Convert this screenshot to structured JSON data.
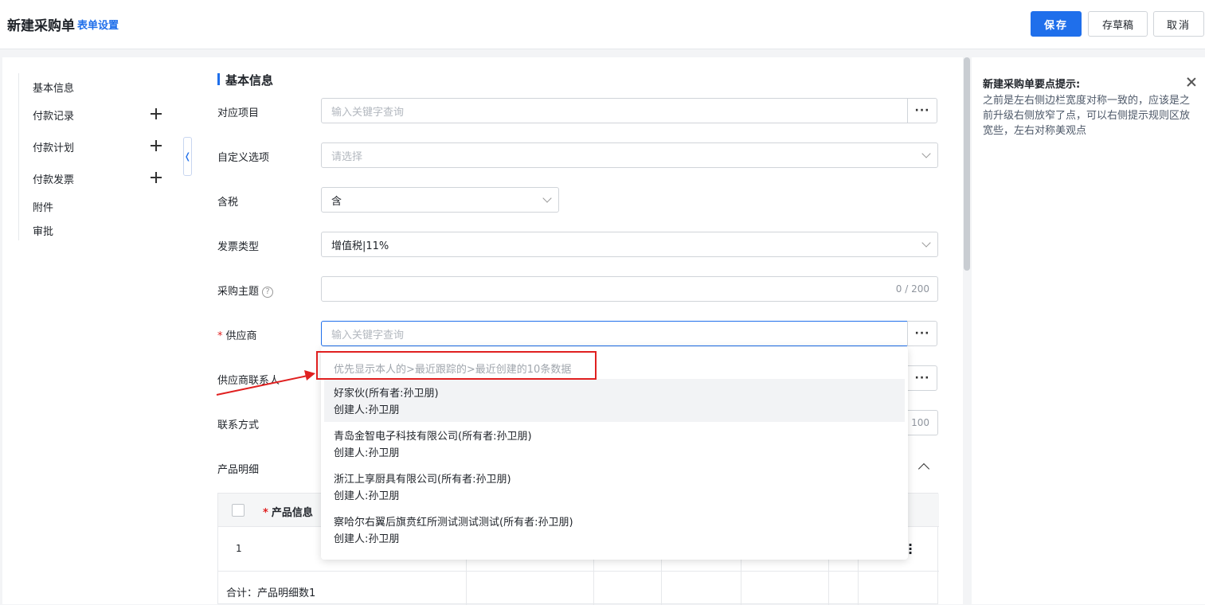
{
  "header": {
    "title": "新建采购单",
    "form_settings": "表单设置",
    "save": "保存",
    "draft": "存草稿",
    "cancel": "取消"
  },
  "sidebar": {
    "items": [
      {
        "label": "基本信息"
      },
      {
        "label": "付款记录"
      },
      {
        "label": "付款计划"
      },
      {
        "label": "付款发票"
      },
      {
        "label": "附件"
      },
      {
        "label": "审批"
      }
    ],
    "collapse_icon": "chevron-left-icon"
  },
  "form": {
    "section_title": "基本信息",
    "fields": {
      "project": {
        "label": "对应项目",
        "placeholder": "输入关键字查询"
      },
      "custom": {
        "label": "自定义选项",
        "placeholder": "请选择"
      },
      "tax": {
        "label": "含税",
        "value": "含"
      },
      "invoice_type": {
        "label": "发票类型",
        "value": "增值税|11%"
      },
      "subject": {
        "label": "采购主题",
        "counter": "0 / 200"
      },
      "supplier": {
        "label": "供应商",
        "required_mark": "*",
        "placeholder": "输入关键字查询"
      },
      "contact": {
        "label": "供应商联系人"
      },
      "contact_method": {
        "label": "联系方式",
        "counter": "100"
      },
      "product_detail": {
        "label": "产品明细"
      }
    },
    "more_button": "···"
  },
  "table": {
    "header_required": "*",
    "header_product": "产品信息",
    "row_index": "1",
    "total": "合计：产品明细数1"
  },
  "dropdown": {
    "hint": "优先显示本人的>最近跟踪的>最近创建的10条数据",
    "items": [
      {
        "name": "好家伙(所有者:孙卫朋)",
        "creator": "创建人:孙卫朋"
      },
      {
        "name": "青岛金智电子科技有限公司(所有者:孙卫朋)",
        "creator": "创建人:孙卫朋"
      },
      {
        "name": "浙江上享厨具有限公司(所有者:孙卫朋)",
        "creator": "创建人:孙卫朋"
      },
      {
        "name": "察哈尔右翼后旗贲红所测试测试测试(所有者:孙卫朋)",
        "creator": "创建人:孙卫朋"
      }
    ]
  },
  "tips": {
    "title": "新建采购单要点提示:",
    "text": "之前是左右侧边栏宽度对称一致的，应该是之前升级右侧放窄了点，可以右侧提示规则区放宽些，左右对称美观点"
  },
  "colors": {
    "accent": "#1f6feb",
    "highlight": "#e02020"
  }
}
